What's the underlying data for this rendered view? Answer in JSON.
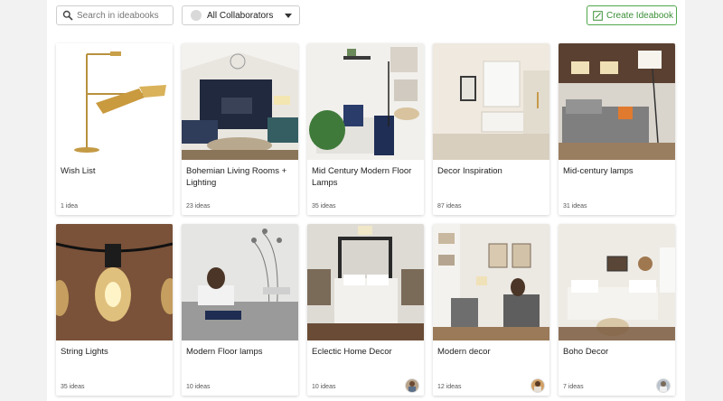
{
  "toolbar": {
    "search_placeholder": "Search in ideabooks",
    "collaborators_label": "All Collaborators",
    "create_label": "Create Ideabook"
  },
  "ideabooks": [
    {
      "title": "Wish List",
      "count": "1 idea"
    },
    {
      "title": "Bohemian Living Rooms + Lighting",
      "count": "23 ideas"
    },
    {
      "title": "Mid Century Modern Floor Lamps",
      "count": "35 ideas"
    },
    {
      "title": "Decor Inspiration",
      "count": "87 ideas"
    },
    {
      "title": "Mid-century lamps",
      "count": "31 ideas"
    },
    {
      "title": "String Lights",
      "count": "35 ideas"
    },
    {
      "title": "Modern Floor lamps",
      "count": "10 ideas"
    },
    {
      "title": "Eclectic Home Decor",
      "count": "10 ideas"
    },
    {
      "title": "Modern decor",
      "count": "12 ideas"
    },
    {
      "title": "Boho Decor",
      "count": "7 ideas"
    }
  ],
  "colors": {
    "accent": "#4fa84a",
    "accent_text": "#3b8f37",
    "page_bg": "#f2f2f2"
  }
}
